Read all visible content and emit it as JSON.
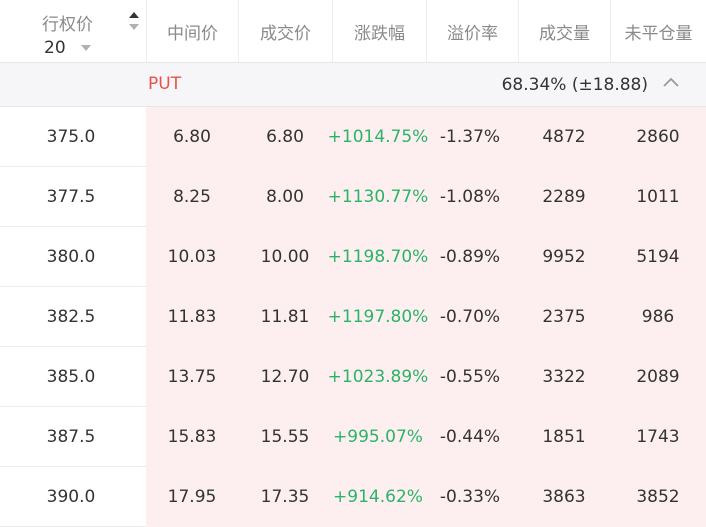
{
  "header": {
    "strike_title": "行权价",
    "strike_value": "20",
    "columns": [
      "中间价",
      "成交价",
      "涨跌幅",
      "溢价率",
      "成交量",
      "未平仓量"
    ]
  },
  "section": {
    "label": "PUT",
    "iv_text": "68.34% (±18.88)"
  },
  "rows": [
    {
      "strike": "375.0",
      "mid": "6.80",
      "last": "6.80",
      "change": "+1014.75%",
      "premium": "-1.37%",
      "volume": "4872",
      "oi": "2860"
    },
    {
      "strike": "377.5",
      "mid": "8.25",
      "last": "8.00",
      "change": "+1130.77%",
      "premium": "-1.08%",
      "volume": "2289",
      "oi": "1011"
    },
    {
      "strike": "380.0",
      "mid": "10.03",
      "last": "10.00",
      "change": "+1198.70%",
      "premium": "-0.89%",
      "volume": "9952",
      "oi": "5194"
    },
    {
      "strike": "382.5",
      "mid": "11.83",
      "last": "11.81",
      "change": "+1197.80%",
      "premium": "-0.70%",
      "volume": "2375",
      "oi": "986"
    },
    {
      "strike": "385.0",
      "mid": "13.75",
      "last": "12.70",
      "change": "+1023.89%",
      "premium": "-0.55%",
      "volume": "3322",
      "oi": "2089"
    },
    {
      "strike": "387.5",
      "mid": "15.83",
      "last": "15.55",
      "change": "+995.07%",
      "premium": "-0.44%",
      "volume": "1851",
      "oi": "1743"
    },
    {
      "strike": "390.0",
      "mid": "17.95",
      "last": "17.35",
      "change": "+914.62%",
      "premium": "-0.33%",
      "volume": "3863",
      "oi": "3852"
    }
  ],
  "colors": {
    "put": "#e9524a",
    "positive": "#2bb369",
    "put_bg": "#fdefef"
  },
  "icons": {
    "sort": "sort-updown-icon",
    "dropdown": "caret-down-icon",
    "collapse": "chevron-up-icon"
  }
}
